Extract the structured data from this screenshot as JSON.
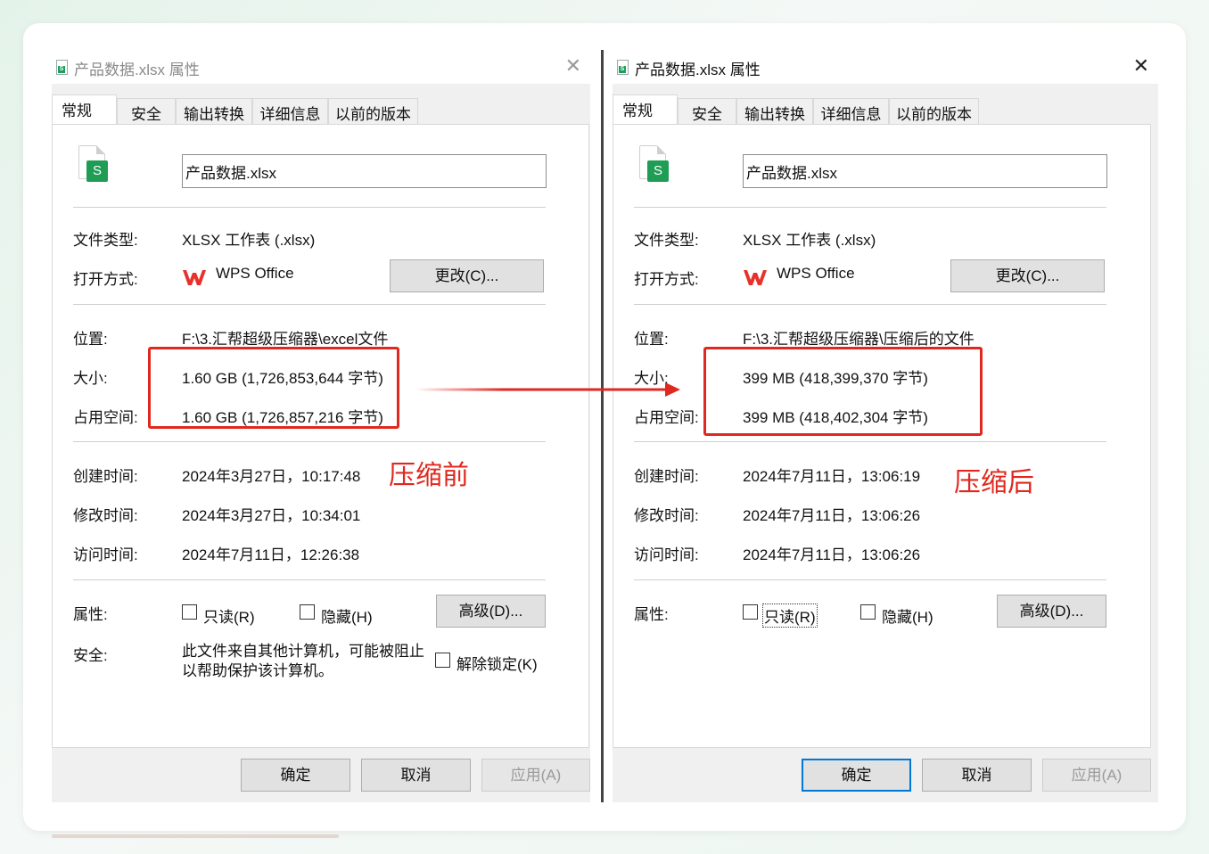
{
  "dialogs": {
    "left": {
      "title": "产品数据.xlsx 属性",
      "close_glyph": "✕",
      "tabs": [
        "常规",
        "安全",
        "输出转换",
        "详细信息",
        "以前的版本"
      ],
      "file_name": "产品数据.xlsx",
      "file_type_label": "文件类型:",
      "file_type_value": "XLSX 工作表 (.xlsx)",
      "open_with_label": "打开方式:",
      "open_with_value": "WPS Office",
      "change_button": "更改(C)...",
      "location_label": "位置:",
      "location_value": "F:\\3.汇帮超级压缩器\\excel文件",
      "size_label": "大小:",
      "size_value": "1.60 GB (1,726,853,644 字节)",
      "disk_label": "占用空间:",
      "disk_value": "1.60 GB (1,726,857,216 字节)",
      "created_label": "创建时间:",
      "created_value": "2024年3月27日，10:17:48",
      "modified_label": "修改时间:",
      "modified_value": "2024年3月27日，10:34:01",
      "accessed_label": "访问时间:",
      "accessed_value": "2024年7月11日，12:26:38",
      "attributes_label": "属性:",
      "readonly_label": "只读(R)",
      "hidden_label": "隐藏(H)",
      "advanced_button": "高级(D)...",
      "security_label": "安全:",
      "security_text": "此文件来自其他计算机，可能被阻止以帮助保护该计算机。",
      "unblock_label": "解除锁定(K)",
      "ok_button": "确定",
      "cancel_button": "取消",
      "apply_button": "应用(A)"
    },
    "right": {
      "title": "产品数据.xlsx 属性",
      "close_glyph": "✕",
      "tabs": [
        "常规",
        "安全",
        "输出转换",
        "详细信息",
        "以前的版本"
      ],
      "file_name": "产品数据.xlsx",
      "file_type_label": "文件类型:",
      "file_type_value": "XLSX 工作表 (.xlsx)",
      "open_with_label": "打开方式:",
      "open_with_value": "WPS Office",
      "change_button": "更改(C)...",
      "location_label": "位置:",
      "location_value": "F:\\3.汇帮超级压缩器\\压缩后的文件",
      "size_label": "大小:",
      "size_value": "399 MB (418,399,370 字节)",
      "disk_label": "占用空间:",
      "disk_value": "399 MB (418,402,304 字节)",
      "created_label": "创建时间:",
      "created_value": "2024年7月11日，13:06:19",
      "modified_label": "修改时间:",
      "modified_value": "2024年7月11日，13:06:26",
      "accessed_label": "访问时间:",
      "accessed_value": "2024年7月11日，13:06:26",
      "attributes_label": "属性:",
      "readonly_label": "只读(R)",
      "hidden_label": "隐藏(H)",
      "advanced_button": "高级(D)...",
      "ok_button": "确定",
      "cancel_button": "取消",
      "apply_button": "应用(A)"
    }
  },
  "annotations": {
    "before_label": "压缩前",
    "after_label": "压缩后",
    "accent_color": "#e0281e"
  }
}
